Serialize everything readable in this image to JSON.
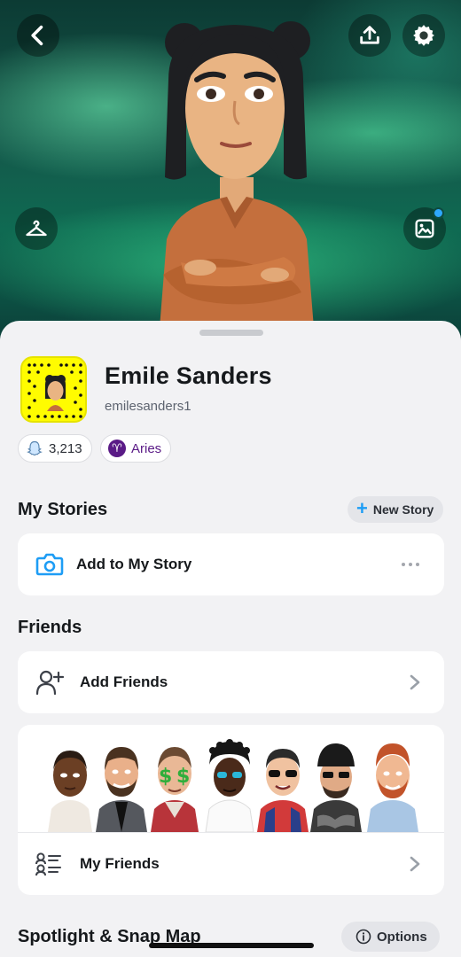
{
  "header": {
    "back_icon": "chevron-left-icon",
    "share_icon": "upload-icon",
    "settings_icon": "gear-icon",
    "wardrobe_icon": "hanger-icon",
    "background_icon": "image-edit-icon"
  },
  "profile": {
    "display_name": "Emile Sanders",
    "username": "emilesanders1",
    "snap_score": "3,213",
    "zodiac": "Aries",
    "zodiac_symbol": "♈"
  },
  "my_stories": {
    "title": "My Stories",
    "new_story_label": "New Story",
    "add_label": "Add to My Story"
  },
  "friends": {
    "title": "Friends",
    "add_friends_label": "Add Friends",
    "my_friends_label": "My Friends"
  },
  "spotlight": {
    "title": "Spotlight & Snap Map",
    "options_label": "Options"
  },
  "colors": {
    "snap_yellow": "#fffc00",
    "accent_blue": "#1e9df5",
    "zodiac_purple": "#5a1a86"
  }
}
